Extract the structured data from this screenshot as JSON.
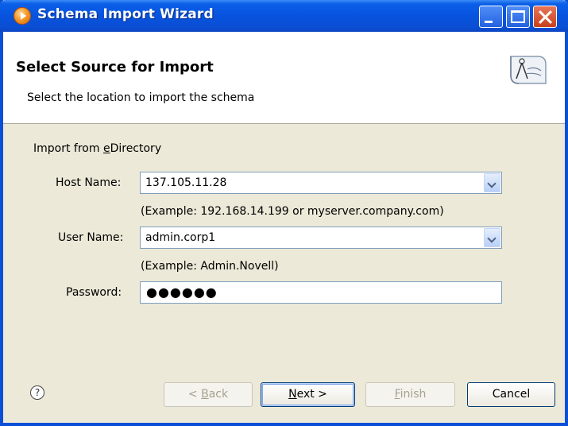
{
  "window": {
    "title": "Schema Import Wizard"
  },
  "header": {
    "title": "Select Source for Import",
    "description": "Select the location to import the schema"
  },
  "form": {
    "section_label_pre": "Import from ",
    "section_label_u": "e",
    "section_label_post": "Directory",
    "host": {
      "label": "Host Name:",
      "value": "137.105.11.28",
      "example": "(Example: 192.168.14.199 or myserver.company.com)"
    },
    "user": {
      "label": "User Name:",
      "value": "admin.corp1",
      "example": "(Example:  Admin.Novell)"
    },
    "password": {
      "label": "Password:",
      "value": "●●●●●●"
    }
  },
  "footer": {
    "help": "?",
    "back_pre": "< ",
    "back_u": "B",
    "back_post": "ack",
    "next_u": "N",
    "next_post": "ext >",
    "finish_u": "F",
    "finish_post": "inish",
    "cancel": "Cancel"
  }
}
